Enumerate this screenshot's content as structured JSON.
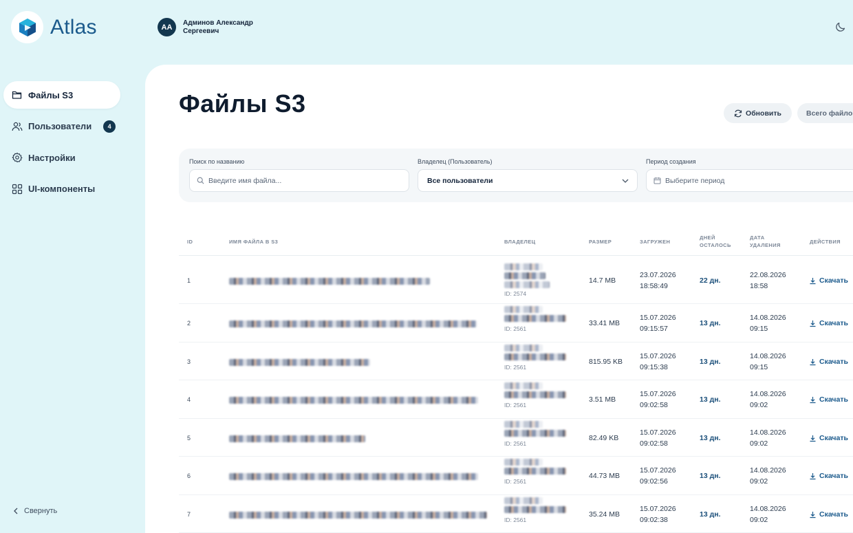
{
  "brand": {
    "name": "Atlas"
  },
  "user": {
    "initials": "АА",
    "name": "Админов Александр Сергеевич"
  },
  "sidebar": {
    "items": [
      {
        "label": "Файлы S3",
        "icon": "folder-icon",
        "active": true
      },
      {
        "label": "Пользователи",
        "icon": "users-icon",
        "badge": "4"
      },
      {
        "label": "Настройки",
        "icon": "gear-icon"
      },
      {
        "label": "UI-компоненты",
        "icon": "grid-icon"
      }
    ],
    "collapse_label": "Свернуть"
  },
  "page": {
    "title": "Файлы S3",
    "refresh_label": "Обновить",
    "total_label": "Всего файлов"
  },
  "filters": {
    "search": {
      "label": "Поиск по названию",
      "placeholder": "Введите имя файла..."
    },
    "owner": {
      "label": "Владелец (Пользователь)",
      "value": "Все пользователи"
    },
    "period": {
      "label": "Период создания",
      "placeholder": "Выберите период"
    }
  },
  "table": {
    "columns": {
      "id": "ID",
      "name": "ИМЯ ФАЙЛА В S3",
      "owner": "ВЛАДЕЛЕЦ",
      "size": "РАЗМЕР",
      "uploaded": "ЗАГРУЖЕН",
      "days_1": "ДНЕЙ",
      "days_2": "ОСТАЛОСЬ",
      "deleted_1": "ДАТА",
      "deleted_2": "УДАЛЕНИЯ",
      "actions": "ДЕЙСТВИЯ"
    },
    "download_label": "Скачать",
    "rows": [
      {
        "id": "1",
        "owner_id": "ID: 2574",
        "size": "14.7 MB",
        "uploaded_date": "23.07.2026",
        "uploaded_time": "18:58:49",
        "days": "22 дн.",
        "delete_date": "22.08.2026",
        "delete_time": "18:58"
      },
      {
        "id": "2",
        "owner_id": "ID: 2561",
        "size": "33.41 MB",
        "uploaded_date": "15.07.2026",
        "uploaded_time": "09:15:57",
        "days": "13 дн.",
        "delete_date": "14.08.2026",
        "delete_time": "09:15"
      },
      {
        "id": "3",
        "owner_id": "ID: 2561",
        "size": "815.95 KB",
        "uploaded_date": "15.07.2026",
        "uploaded_time": "09:15:38",
        "days": "13 дн.",
        "delete_date": "14.08.2026",
        "delete_time": "09:15"
      },
      {
        "id": "4",
        "owner_id": "ID: 2561",
        "size": "3.51 MB",
        "uploaded_date": "15.07.2026",
        "uploaded_time": "09:02:58",
        "days": "13 дн.",
        "delete_date": "14.08.2026",
        "delete_time": "09:02"
      },
      {
        "id": "5",
        "owner_id": "ID: 2561",
        "size": "82.49 KB",
        "uploaded_date": "15.07.2026",
        "uploaded_time": "09:02:58",
        "days": "13 дн.",
        "delete_date": "14.08.2026",
        "delete_time": "09:02"
      },
      {
        "id": "6",
        "owner_id": "ID: 2561",
        "size": "44.73 MB",
        "uploaded_date": "15.07.2026",
        "uploaded_time": "09:02:56",
        "days": "13 дн.",
        "delete_date": "14.08.2026",
        "delete_time": "09:02"
      },
      {
        "id": "7",
        "owner_id": "ID: 2561",
        "size": "35.24 MB",
        "uploaded_date": "15.07.2026",
        "uploaded_time": "09:02:38",
        "days": "13 дн.",
        "delete_date": "14.08.2026",
        "delete_time": "09:02"
      }
    ]
  },
  "colors": {
    "accent": "#1b5a8c",
    "badge": "#13374f",
    "background": "#e0f5f8"
  }
}
